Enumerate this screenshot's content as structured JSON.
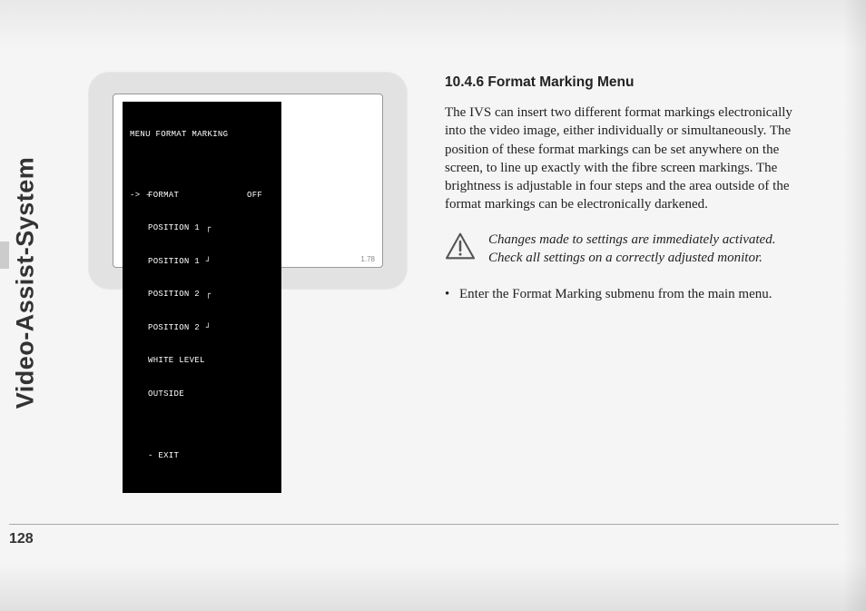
{
  "side_label": "Video-Assist-System",
  "page_number": "128",
  "figure": {
    "version": "1.78",
    "menu": {
      "title": "MENU FORMAT MARKING",
      "rows": [
        {
          "cursor": "-> -",
          "label": "FORMAT",
          "glyph": "",
          "value": "OFF"
        },
        {
          "cursor": "",
          "label": "POSITION 1",
          "glyph": "┌",
          "value": ""
        },
        {
          "cursor": "",
          "label": "POSITION 1",
          "glyph": "┘",
          "value": ""
        },
        {
          "cursor": "",
          "label": "POSITION 2",
          "glyph": "┌",
          "value": ""
        },
        {
          "cursor": "",
          "label": "POSITION 2",
          "glyph": "┘",
          "value": ""
        },
        {
          "cursor": "",
          "label": "WHITE LEVEL",
          "glyph": "",
          "value": ""
        },
        {
          "cursor": "",
          "label": "OUTSIDE",
          "glyph": "",
          "value": ""
        }
      ],
      "exit": "- EXIT"
    }
  },
  "content": {
    "heading": "10.4.6 Format Marking Menu",
    "paragraph": "The IVS can insert two different format markings electronically into the video image, either individually or simultaneously. The position of these format markings can be set anywhere on the screen, to line up exactly with the fibre screen markings. The brightness is adjustable in four steps and the area outside of the format markings can be electronically darkened.",
    "note": "Changes made to settings are immediately activated. Check all settings on a correctly adjusted monitor.",
    "bullet": "Enter the Format Marking submenu from the main menu."
  }
}
